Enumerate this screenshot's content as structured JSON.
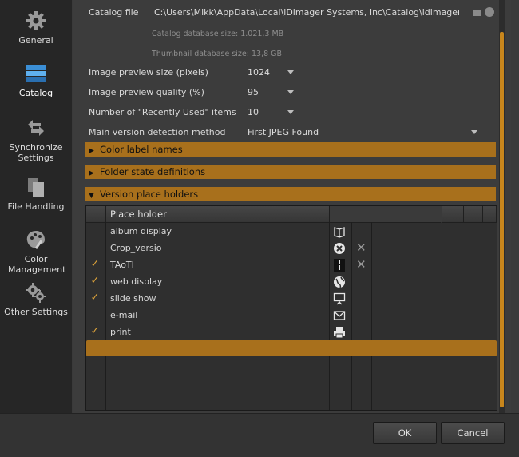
{
  "sidebar": {
    "items": [
      {
        "label": "General",
        "icon": "gear-icon"
      },
      {
        "label": "Catalog",
        "icon": "catalog-icon"
      },
      {
        "label": "Synchronize Settings",
        "icon": "sync-arrows-icon"
      },
      {
        "label": "File Handling",
        "icon": "files-icon"
      },
      {
        "label": "Color Management",
        "icon": "palette-icon"
      },
      {
        "label": "Other Settings",
        "icon": "gears-icon"
      }
    ],
    "active": "Catalog"
  },
  "catalog": {
    "catalog_file_label": "Catalog file",
    "catalog_file_value": "C:\\Users\\Mikk\\AppData\\Local\\iDimager Systems, Inc\\Catalog\\idimager.zdb",
    "db_size_label": "Catalog database size: 1.021,3 MB",
    "thumb_size_label": "Thumbnail database size: 13,8 GB",
    "preview_size_label": "Image preview size (pixels)",
    "preview_size_value": "1024",
    "preview_quality_label": "Image preview quality (%)",
    "preview_quality_value": "95",
    "recent_label": "Number of \"Recently Used\" items",
    "recent_value": "10",
    "version_method_label": "Main version detection method",
    "version_method_value": "First JPEG Found"
  },
  "sections": [
    {
      "label": "Color label names",
      "expanded": false
    },
    {
      "label": "Folder state definitions",
      "expanded": false
    },
    {
      "label": "Version place holders",
      "expanded": true
    }
  ],
  "table": {
    "header": "Place holder",
    "rows": [
      {
        "checked": false,
        "name": "album display",
        "icon": "album-book-icon",
        "deletable": false
      },
      {
        "checked": false,
        "name": "Crop_versio",
        "icon": "crop-remove-icon",
        "deletable": true
      },
      {
        "checked": true,
        "name": "TAoTI",
        "icon": "bar-marker-icon",
        "deletable": true
      },
      {
        "checked": true,
        "name": "web display",
        "icon": "globe-icon",
        "deletable": false
      },
      {
        "checked": true,
        "name": "slide show",
        "icon": "projector-screen-icon",
        "deletable": false
      },
      {
        "checked": false,
        "name": "e-mail",
        "icon": "envelope-icon",
        "deletable": false
      },
      {
        "checked": true,
        "name": "print",
        "icon": "printer-icon",
        "deletable": false
      }
    ],
    "check_glyph": "✓",
    "delete_glyph": "✕"
  },
  "footer": {
    "ok_label": "OK",
    "cancel_label": "Cancel"
  },
  "colors": {
    "accent": "#a8701c",
    "scroll_thumb": "#c8861c",
    "check": "#e0a53a"
  }
}
